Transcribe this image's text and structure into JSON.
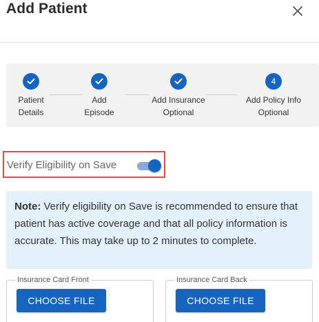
{
  "dialog": {
    "title": "Add Patient"
  },
  "stepper": {
    "steps": [
      {
        "label_line1": "Patient",
        "label_line2": "Details",
        "state": "completed",
        "number": ""
      },
      {
        "label_line1": "Add",
        "label_line2": "Episode",
        "state": "completed",
        "number": ""
      },
      {
        "label_line1": "Add Insurance",
        "label_line2": "Optional",
        "state": "completed",
        "number": ""
      },
      {
        "label_line1": "Add Policy Info",
        "label_line2": "Optional",
        "state": "active",
        "number": "4"
      }
    ]
  },
  "verify": {
    "label": "Verify Eligibility on Save",
    "enabled": true
  },
  "note": {
    "prefix": "Note:",
    "text": " Verify eligibility on Save is recommended to ensure that patient has active coverage and that all policy information is accurate. This may take up to 2 minutes to complete."
  },
  "upload": {
    "front": {
      "legend": "Insurance Card Front",
      "button": "CHOOSE FILE"
    },
    "back": {
      "legend": "Insurance Card Back",
      "button": "CHOOSE FILE"
    }
  },
  "colors": {
    "primary": "#1565c0",
    "highlight_border": "#e8463b",
    "note_background": "#e3f1fb",
    "stepper_background": "#f2f2f2"
  }
}
